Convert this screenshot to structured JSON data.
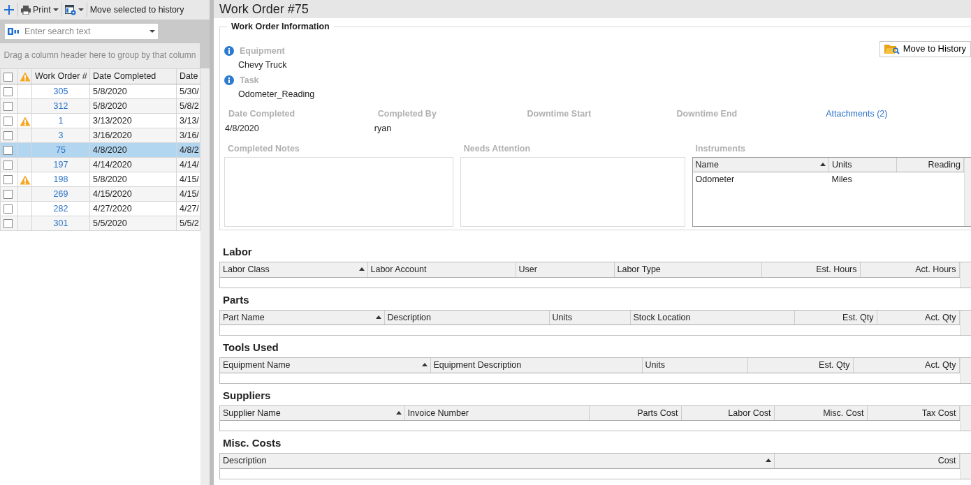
{
  "toolbar": {
    "print_label": "Print",
    "move_label": "Move selected to history"
  },
  "search": {
    "placeholder": "Enter search text"
  },
  "group_panel": {
    "hint": "Drag a column header here to group by that column"
  },
  "grid": {
    "header_checked": false,
    "columns": [
      "Work Order #",
      "Date Completed",
      "Date"
    ],
    "rows": [
      {
        "checked": false,
        "warning": false,
        "selected": false,
        "work_order": "305",
        "date_completed": "5/8/2020",
        "date": "5/30/"
      },
      {
        "checked": false,
        "warning": false,
        "selected": false,
        "work_order": "312",
        "date_completed": "5/8/2020",
        "date": "5/8/2"
      },
      {
        "checked": false,
        "warning": true,
        "selected": false,
        "work_order": "1",
        "date_completed": "3/13/2020",
        "date": "3/13/"
      },
      {
        "checked": false,
        "warning": false,
        "selected": false,
        "work_order": "3",
        "date_completed": "3/16/2020",
        "date": "3/16/"
      },
      {
        "checked": false,
        "warning": false,
        "selected": true,
        "work_order": "75",
        "date_completed": "4/8/2020",
        "date": "4/8/2"
      },
      {
        "checked": false,
        "warning": false,
        "selected": false,
        "work_order": "197",
        "date_completed": "4/14/2020",
        "date": "4/14/"
      },
      {
        "checked": false,
        "warning": true,
        "selected": false,
        "work_order": "198",
        "date_completed": "5/8/2020",
        "date": "4/15/"
      },
      {
        "checked": false,
        "warning": false,
        "selected": false,
        "work_order": "269",
        "date_completed": "4/15/2020",
        "date": "4/15/"
      },
      {
        "checked": false,
        "warning": false,
        "selected": false,
        "work_order": "282",
        "date_completed": "4/27/2020",
        "date": "4/27/"
      },
      {
        "checked": false,
        "warning": false,
        "selected": false,
        "work_order": "301",
        "date_completed": "5/5/2020",
        "date": "5/5/2"
      }
    ]
  },
  "detail": {
    "title": "Work Order #75",
    "info": {
      "legend": "Work Order Information",
      "move_button": "Move to History",
      "equipment": {
        "label": "Equipment",
        "value": "Chevy Truck"
      },
      "task": {
        "label": "Task",
        "value": "Odometer_Reading"
      },
      "fields": [
        {
          "kind": "field",
          "label": "Date Completed",
          "value": "4/8/2020"
        },
        {
          "kind": "field",
          "label": "Completed By",
          "value": "ryan"
        },
        {
          "kind": "field",
          "label": "Downtime Start"
        },
        {
          "kind": "field",
          "label": "Downtime End"
        },
        {
          "kind": "link",
          "label": "Attachments (2)"
        }
      ],
      "notes": [
        {
          "label": "Completed Notes"
        },
        {
          "label": "Needs Attention"
        }
      ],
      "instruments": {
        "label": "Instruments",
        "columns": [
          {
            "label": "Name",
            "sorted": true,
            "numeric": false
          },
          {
            "label": "Units",
            "sorted": false,
            "numeric": false
          },
          {
            "label": "Reading",
            "sorted": false,
            "numeric": true
          }
        ],
        "rows": [
          {
            "name": "Odometer",
            "units": "Miles"
          }
        ]
      }
    },
    "sections": [
      {
        "title": "Labor",
        "columns": [
          {
            "label": "Labor Class",
            "sorted": true,
            "numeric": false
          },
          {
            "label": "Labor Account",
            "sorted": false,
            "numeric": false
          },
          {
            "label": "User",
            "sorted": false,
            "numeric": false
          },
          {
            "label": "Labor Type",
            "sorted": false,
            "numeric": false
          },
          {
            "label": "Est. Hours",
            "sorted": false,
            "numeric": true
          },
          {
            "label": "Act. Hours",
            "sorted": false,
            "numeric": true
          }
        ]
      },
      {
        "title": "Parts",
        "columns": [
          {
            "label": "Part Name",
            "sorted": true,
            "numeric": false
          },
          {
            "label": "Description",
            "sorted": false,
            "numeric": false
          },
          {
            "label": "Units",
            "sorted": false,
            "numeric": false
          },
          {
            "label": "Stock Location",
            "sorted": false,
            "numeric": false
          },
          {
            "label": "Est. Qty",
            "sorted": false,
            "numeric": true
          },
          {
            "label": "Act. Qty",
            "sorted": false,
            "numeric": true
          }
        ]
      },
      {
        "title": "Tools Used",
        "columns": [
          {
            "label": "Equipment Name",
            "sorted": true,
            "numeric": false
          },
          {
            "label": "Equipment Description",
            "sorted": false,
            "numeric": false
          },
          {
            "label": "Units",
            "sorted": false,
            "numeric": false
          },
          {
            "label": "Est. Qty",
            "sorted": false,
            "numeric": true
          },
          {
            "label": "Act. Qty",
            "sorted": false,
            "numeric": true
          }
        ]
      },
      {
        "title": "Suppliers",
        "columns": [
          {
            "label": "Supplier Name",
            "sorted": true,
            "numeric": false
          },
          {
            "label": "Invoice Number",
            "sorted": false,
            "numeric": false
          },
          {
            "label": "Parts Cost",
            "sorted": false,
            "numeric": true
          },
          {
            "label": "Labor Cost",
            "sorted": false,
            "numeric": true
          },
          {
            "label": "Misc. Cost",
            "sorted": false,
            "numeric": true
          },
          {
            "label": "Tax Cost",
            "sorted": false,
            "numeric": true
          }
        ]
      },
      {
        "title": "Misc. Costs",
        "columns": [
          {
            "label": "Description",
            "sorted": true,
            "numeric": false
          },
          {
            "label": "Cost",
            "sorted": false,
            "numeric": true
          }
        ]
      }
    ]
  }
}
